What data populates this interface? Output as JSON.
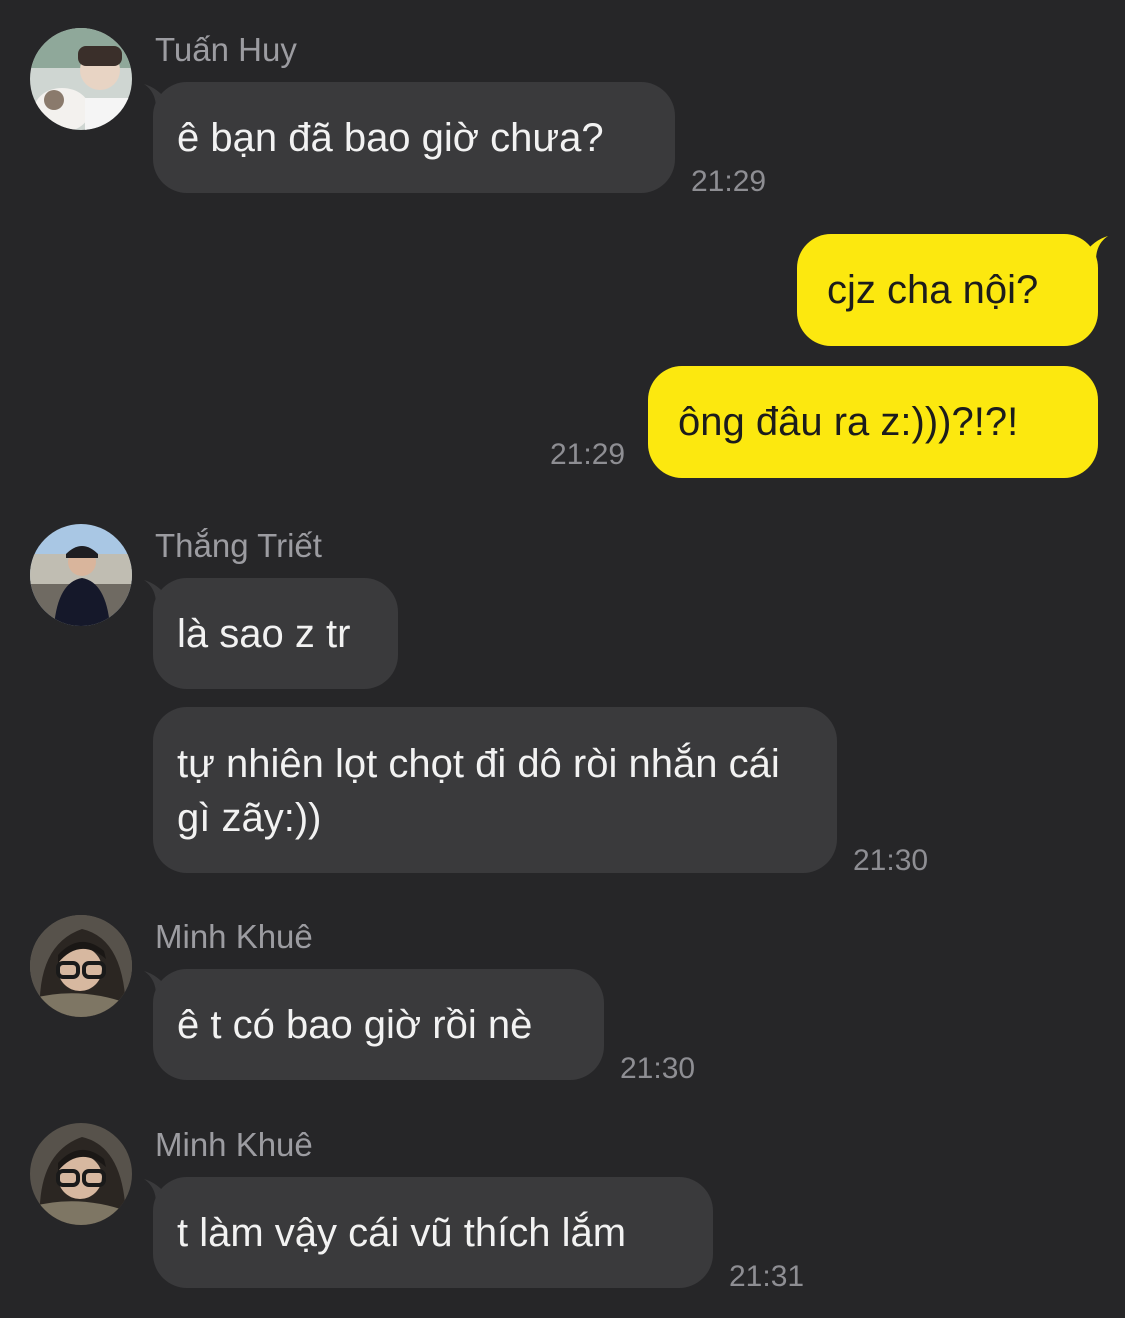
{
  "colors": {
    "background": "#262628",
    "incoming_bubble": "#3a3a3c",
    "outgoing_bubble": "#fce80f",
    "sender_name": "#9c9ca1",
    "timestamp": "#8e8e93"
  },
  "messages": [
    {
      "sender": "Tuấn Huy",
      "text": "ê bạn đã bao giờ chưa?",
      "time": "21:29",
      "direction": "incoming",
      "avatar_icon": "user-avatar-icon"
    },
    {
      "text": "cjz cha nội?",
      "direction": "outgoing"
    },
    {
      "text": "ông đâu ra z:)))?!?!",
      "time": "21:29",
      "direction": "outgoing"
    },
    {
      "sender": "Thắng Triết",
      "text": "là sao z tr",
      "direction": "incoming",
      "avatar_icon": "user-avatar-icon"
    },
    {
      "text": "tự nhiên lọt chọt đi dô ròi nhắn cái gì zãy:))",
      "time": "21:30",
      "direction": "incoming"
    },
    {
      "sender": "Minh Khuê",
      "text": "ê t có bao giờ rồi nè",
      "time": "21:30",
      "direction": "incoming",
      "avatar_icon": "user-avatar-icon"
    },
    {
      "sender": "Minh Khuê",
      "text": "t làm vậy cái vũ thích lắm",
      "time": "21:31",
      "direction": "incoming",
      "avatar_icon": "user-avatar-icon"
    }
  ]
}
